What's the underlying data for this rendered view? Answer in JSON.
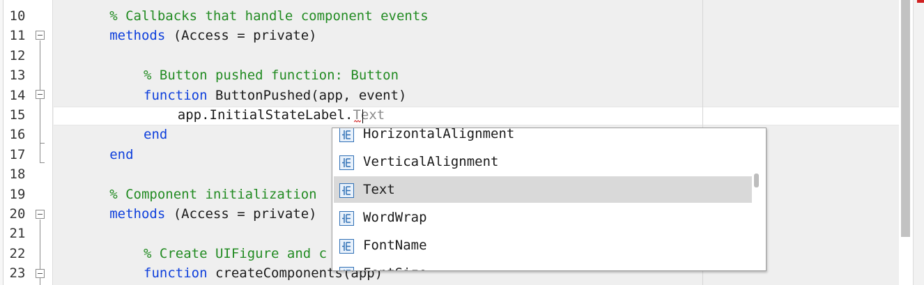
{
  "editor": {
    "lines": [
      {
        "number": "10",
        "parts": [
          {
            "t": "cm",
            "v": "% Callbacks that handle component events"
          }
        ]
      },
      {
        "number": "11",
        "parts": [
          {
            "t": "kw",
            "v": "methods"
          },
          {
            "t": "tx",
            "v": " (Access = private)"
          }
        ]
      },
      {
        "number": "12",
        "parts": []
      },
      {
        "number": "13",
        "parts": [
          {
            "t": "cm",
            "v": "% Button pushed function: Button"
          }
        ]
      },
      {
        "number": "14",
        "parts": [
          {
            "t": "kw",
            "v": "function"
          },
          {
            "t": "tx",
            "v": " ButtonPushed(app, event)"
          }
        ]
      },
      {
        "number": "15",
        "parts": [
          {
            "t": "tx",
            "v": "app.InitialStateLabel."
          },
          {
            "t": "hint",
            "v": "Text"
          }
        ]
      },
      {
        "number": "16",
        "parts": [
          {
            "t": "kw",
            "v": "end"
          }
        ]
      },
      {
        "number": "17",
        "parts": [
          {
            "t": "kw",
            "v": "end"
          }
        ]
      },
      {
        "number": "18",
        "parts": []
      },
      {
        "number": "19",
        "parts": [
          {
            "t": "cm",
            "v": "% Component initialization"
          }
        ]
      },
      {
        "number": "20",
        "parts": [
          {
            "t": "kw",
            "v": "methods"
          },
          {
            "t": "tx",
            "v": " (Access = private)"
          }
        ]
      },
      {
        "number": "21",
        "parts": []
      },
      {
        "number": "22",
        "parts": [
          {
            "t": "cm",
            "v": "% Create UIFigure and c"
          }
        ]
      },
      {
        "number": "23",
        "parts": [
          {
            "t": "kw",
            "v": "function"
          },
          {
            "t": "tx",
            "v": " createComponents(app)"
          }
        ]
      }
    ]
  },
  "autocomplete": {
    "items": [
      {
        "label": "HorizontalAlignment",
        "icon": "property-icon"
      },
      {
        "label": "VerticalAlignment",
        "icon": "property-icon"
      },
      {
        "label": "Text",
        "icon": "property-icon",
        "selected": true
      },
      {
        "label": "WordWrap",
        "icon": "property-icon"
      },
      {
        "label": "FontName",
        "icon": "property-icon"
      },
      {
        "label": "FontSize",
        "icon": "property-icon"
      }
    ]
  },
  "colors": {
    "keyword": "#0e3fdc",
    "comment": "#228b22",
    "selection": "#d9d9d9",
    "error": "#d02020"
  }
}
